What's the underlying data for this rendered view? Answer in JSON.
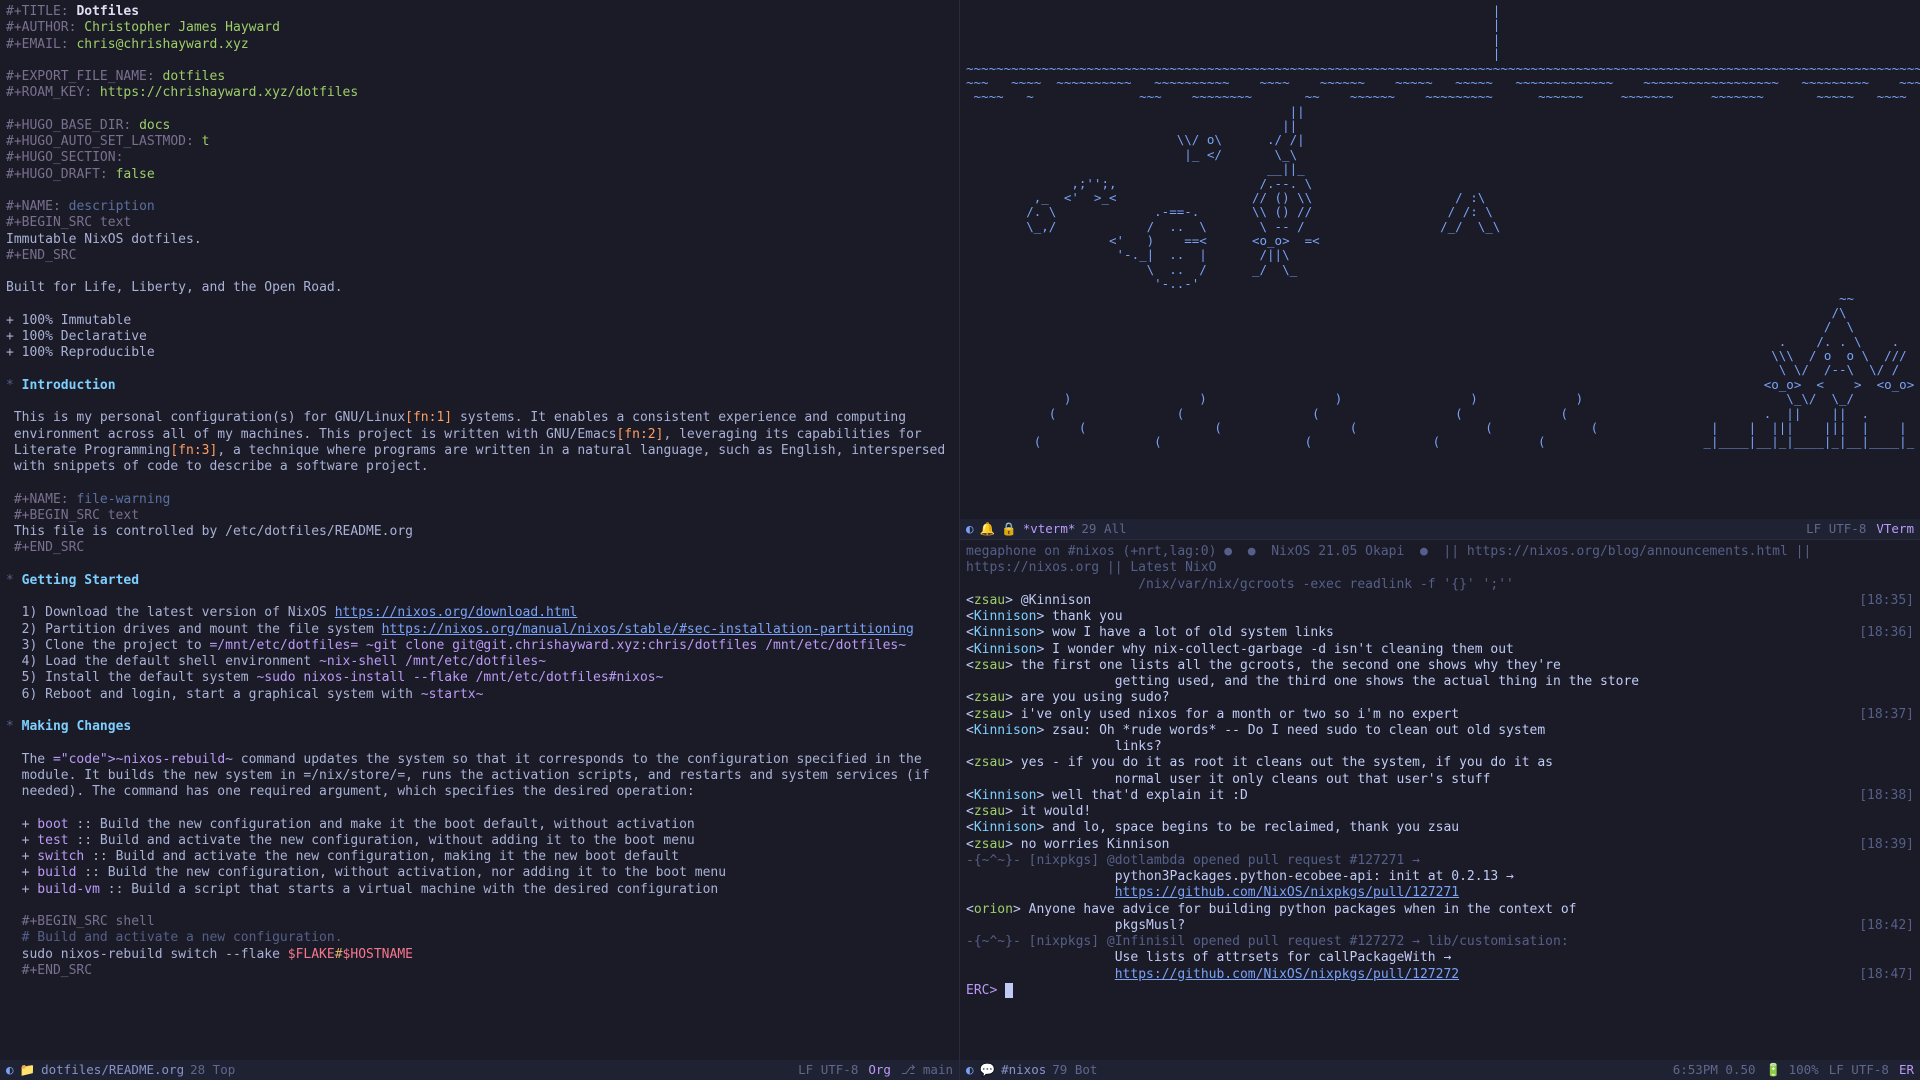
{
  "editor": {
    "header": {
      "title_kw": "#+TITLE:",
      "title": "Dotfiles",
      "author_kw": "#+AUTHOR:",
      "author": "Christopher James Hayward",
      "email_kw": "#+EMAIL:",
      "email": "chris@chrishayward.xyz",
      "export_kw": "#+EXPORT_FILE_NAME:",
      "export": "dotfiles",
      "roam_kw": "#+ROAM_KEY:",
      "roam": "https://chrishayward.xyz/dotfiles",
      "hugo_base_kw": "#+HUGO_BASE_DIR:",
      "hugo_base": "docs",
      "hugo_lastmod_kw": "#+HUGO_AUTO_SET_LASTMOD:",
      "hugo_lastmod": "t",
      "hugo_section_kw": "#+HUGO_SECTION:",
      "hugo_draft_kw": "#+HUGO_DRAFT:",
      "hugo_draft": "false"
    },
    "desc_block": {
      "name_kw": "#+NAME:",
      "name": "description",
      "begin_kw": "#+BEGIN_SRC text",
      "body": "Immutable NixOS dotfiles.",
      "end_kw": "#+END_SRC"
    },
    "tagline": "Built for Life, Liberty, and the Open Road.",
    "bullets": [
      "100% Immutable",
      "100% Declarative",
      "100% Reproducible"
    ],
    "sections": {
      "intro_h": "Introduction",
      "intro_p": "This is my personal configuration(s) for GNU/Linux[fn:1] systems. It enables a consistent experience and computing environment across all of my machines. This project is written with GNU/Emacs[fn:2], leveraging its capabilities for Literate Programming[fn:3], a technique where programs are written in a natural language, such as English, interspersed with snippets of code to describe a software project.",
      "warn_name_kw": "#+NAME:",
      "warn_name": "file-warning",
      "warn_begin": "#+BEGIN_SRC text",
      "warn_body": "This file is controlled by /etc/dotfiles/README.org",
      "warn_end": "#+END_SRC",
      "gs_h": "Getting Started",
      "gs": [
        {
          "n": "1)",
          "t": "Download the latest version of NixOS ",
          "url": "https://nixos.org/download.html"
        },
        {
          "n": "2)",
          "t": "Partition drives and mount the file system ",
          "url": "https://nixos.org/manual/nixos/stable/#sec-installation-partitioning"
        },
        {
          "n": "3)",
          "t": "Clone the project to ",
          "code": "=/mnt/etc/dotfiles=",
          "code2": "~git clone git@git.chrishayward.xyz:chris/dotfiles /mnt/etc/dotfiles~"
        },
        {
          "n": "4)",
          "t": "Load the default shell environment ",
          "code": "~nix-shell /mnt/etc/dotfiles~"
        },
        {
          "n": "5)",
          "t": "Install the default system ",
          "code": "~sudo nixos-install --flake /mnt/etc/dotfiles#nixos~"
        },
        {
          "n": "6)",
          "t": "Reboot and login, start a graphical system with ",
          "code": "~startx~"
        }
      ],
      "mc_h": "Making Changes",
      "mc_p1": "The ~nixos-rebuild~ command updates the system so that it corresponds to the configuration specified in the module. It builds the new system in =/nix/store/=, runs the activation scripts, and restarts and system services (if needed). The command has one required argument, which specifies the desired operation:",
      "mc_ops": [
        {
          "k": "boot",
          "d": "Build the new configuration and make it the boot default, without activation"
        },
        {
          "k": "test",
          "d": "Build and activate the new configuration, without adding it to the boot menu"
        },
        {
          "k": "switch",
          "d": "Build and activate the new configuration, making it the new boot default"
        },
        {
          "k": "build",
          "d": "Build the new configuration, without activation, nor adding it to the boot menu"
        },
        {
          "k": "build-vm",
          "d": "Build a script that starts a virtual machine with the desired configuration"
        }
      ],
      "mc_begin": "#+BEGIN_SRC shell",
      "mc_cmt": "# Build and activate a new configuration.",
      "mc_cmd_a": "sudo nixos-rebuild switch --flake ",
      "mc_cmd_b": "$FLAKE",
      "mc_cmd_c": "#",
      "mc_cmd_d": "$HOSTNAME",
      "mc_end": "#+END_SRC"
    },
    "modeline": {
      "file": "dotfiles/README.org",
      "pos": "28 Top",
      "enc": "LF UTF-8",
      "mode": "Org",
      "vc": "main"
    }
  },
  "vterm": {
    "ascii": "                                                                      |\n                                                                      |\n                                                                      |\n                                                                      |\n~~~~~~~~~~~~~~~~~~~~~~~~~~~~~~~~~~~~~~~~~~~~~~~~~~~~~~~~~~~~~~~~~~~~~~~~~~~~~~~~~~~~~~~~~~~~~~~~~~~~~~~~~~~~~~~~~~~~~~~~~~~~~~~~~~~~~~\n~~~   ~~~~  ~~~~~~~~~~   ~~~~~~~~~~    ~~~~    ~~~~~~    ~~~~~   ~~~~~   ~~~~~~~~~~~~~    ~~~~~~~~~~~~~~~~~~   ~~~~~~~~~    ~~~   ~~~~\n ~~~~   ~              ~~~    ~~~~~~~~       ~~    ~~~~~~    ~~~~~~~~~      ~~~~~~     ~~~~~~~     ~~~~~~~       ~~~~~   ~~~~   ~~~~~~\n                                           ||\n                                          ||\n                            \\\\/ o\\      ./ /|\n                             |_ </       \\_\\\n                                        __||_\n              ,;'';,                   /.--. \\\n         ,_  <'  >_<                  // () \\\\                   / :\\\n        /. \\             .-==-.       \\\\ () //                  / /: \\\n        \\_,/            /  ..  \\       \\ -- /                  /_/  \\_\\\n                   <'   )    ==<      <o_o>  =<\n                    '-._|  ..  |       /||\\\n                        \\  ..  /      _/  \\_\n                         '-..-'\n                                                                                                                    ~~\n                                                                                                                   /\\\n                                                                                                                  /  \\\n                                                                                                            .    /. . \\    .\n                                                                                                           \\\\\\  / o  o \\  ///\n                                                                                                            \\ \\/  /--\\  \\/ /\n                                                                                                          <o_o>  <    >  <o_o>\n             )                 )                 )                 )             )                           \\_\\/  \\_/\n           (                (                 (                  (             (                          .  ||    ||  .\n               (                 (                 (                 (             (               |    |  |||    |||  |    |\n         (               (                   (                (             (                     _|____|__|_|____|_|__|____|_",
    "modeline": {
      "buf": "*vterm*",
      "pos": "29 All",
      "enc": "LF UTF-8",
      "mode": "VTerm"
    }
  },
  "irc": {
    "topic": "megaphone on #nixos (+nrt,lag:0) ●  ●  NixOS 21.05 Okapi  ●  || https://nixos.org/blog/announcements.html || https://nixos.org || Latest NixO",
    "topic2": "                      /nix/var/nix/gcroots -exec readlink -f '{}' ';''",
    "lines": [
      {
        "nick": "zsau",
        "text": "@Kinnison",
        "ts": "[18:35]"
      },
      {
        "nick": "Kinnison",
        "text": "thank you"
      },
      {
        "nick": "Kinnison",
        "text": "wow I have a lot of old system links",
        "ts": "[18:36]"
      },
      {
        "nick": "Kinnison",
        "text": "I wonder why nix-collect-garbage -d isn't cleaning them out"
      },
      {
        "nick": "zsau",
        "text": "the first one lists all the gcroots, the second one shows why they're"
      },
      {
        "cont": true,
        "text": "getting used, and the third one shows the actual thing in the store"
      },
      {
        "nick": "zsau",
        "text": "are you using sudo?"
      },
      {
        "nick": "zsau",
        "text": "i've only used nixos for a month or two so i'm no expert",
        "ts": "[18:37]"
      },
      {
        "nick": "Kinnison",
        "text": "zsau: Oh *rude words* -- Do I need sudo to clean out old system"
      },
      {
        "cont": true,
        "text": "links?"
      },
      {
        "nick": "zsau",
        "text": "yes - if you do it as root it cleans out the system, if you do it as"
      },
      {
        "cont": true,
        "text": "normal user it only cleans out that user's stuff"
      },
      {
        "nick": "Kinnison",
        "text": "well that'd explain it :D",
        "ts": "[18:38]"
      },
      {
        "nick": "zsau",
        "text": "it would!"
      },
      {
        "nick": "Kinnison",
        "text": "and lo, space begins to be reclaimed, thank you zsau"
      },
      {
        "nick": "zsau",
        "text": "no worries Kinnison",
        "ts": "[18:39]"
      },
      {
        "sys": true,
        "pre": "-{~^~}-",
        "text": "[nixpkgs] @dotlambda opened pull request #127271 →"
      },
      {
        "cont": true,
        "text": "python3Packages.python-ecobee-api: init at 0.2.13 →"
      },
      {
        "cont": true,
        "url": "https://github.com/NixOS/nixpkgs/pull/127271"
      },
      {
        "nick": "orion",
        "text": "Anyone have advice for building python packages when in the context of"
      },
      {
        "cont": true,
        "text": "pkgsMusl?",
        "ts": "[18:42]"
      },
      {
        "sys": true,
        "pre": "-{~^~}-",
        "text": "[nixpkgs] @Infinisil opened pull request #127272 → lib/customisation:"
      },
      {
        "cont": true,
        "text": "Use lists of attrsets for callPackageWith →"
      },
      {
        "cont": true,
        "url": "https://github.com/NixOS/nixpkgs/pull/127272",
        "ts": "[18:47]"
      }
    ],
    "prompt": "ERC> ",
    "modeline": {
      "buf": "#nixos",
      "pos": "79 Bot",
      "clock": "6:53PM 0.50",
      "bat": "100%",
      "enc": "LF UTF-8",
      "mode": "ER"
    }
  }
}
